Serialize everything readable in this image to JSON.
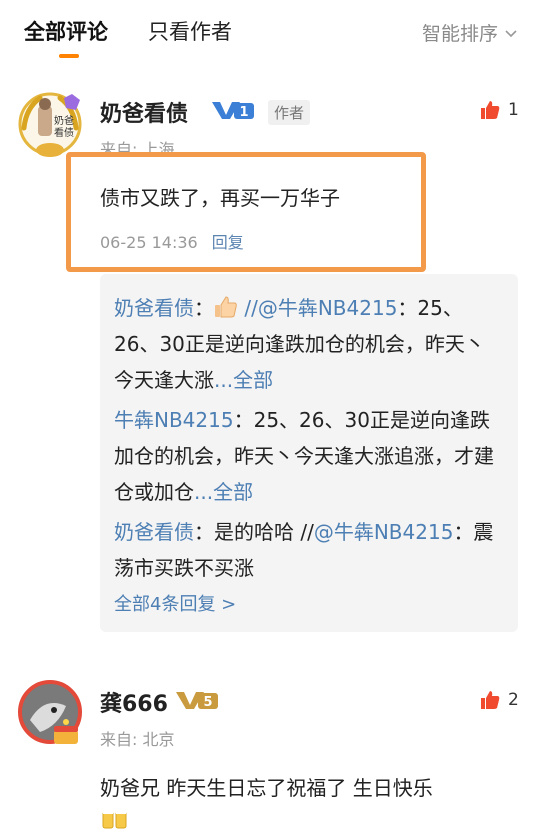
{
  "tabs": {
    "all_comments": "全部评论",
    "author_only": "只看作者",
    "sort": "智能排序"
  },
  "comments": [
    {
      "username": "奶爸看债",
      "avatar_text": "奶爸\n看债",
      "level": "1",
      "author_tag": "作者",
      "from": "来自: 上海",
      "like_count": "1",
      "content": "债市又跌了，再买一万华子",
      "time": "06-25 14:36",
      "reply_label": "回复",
      "replies": [
        {
          "user": "奶爸看债",
          "colon": "：",
          "mention": "//@牛犇NB4215",
          "text": "：25、26、30正是逆向逢跌加仓的机会，昨天丶今天逢大涨",
          "more": "...全部"
        },
        {
          "user": "牛犇NB4215",
          "colon": "：",
          "text": "25、26、30正是逆向逢跌加仓的机会，昨天丶今天逢大涨追涨，才建仓或加仓",
          "more": "...全部"
        },
        {
          "user": "奶爸看债",
          "colon": "：",
          "text": "是的哈哈 //",
          "mention": "@牛犇NB4215",
          "text2": "：震荡市买跌不买涨"
        }
      ],
      "more_replies": "全部4条回复 >"
    },
    {
      "username": "龚666",
      "level": "5",
      "from": "来自: 北京",
      "like_count": "2",
      "content": "奶爸兄 昨天生日忘了祝福了 生日快乐"
    }
  ],
  "colors": {
    "accent": "#ff8200",
    "link": "#4d7fb4",
    "highlight_border": "#f39a4a",
    "like_red": "#f04b2e"
  }
}
